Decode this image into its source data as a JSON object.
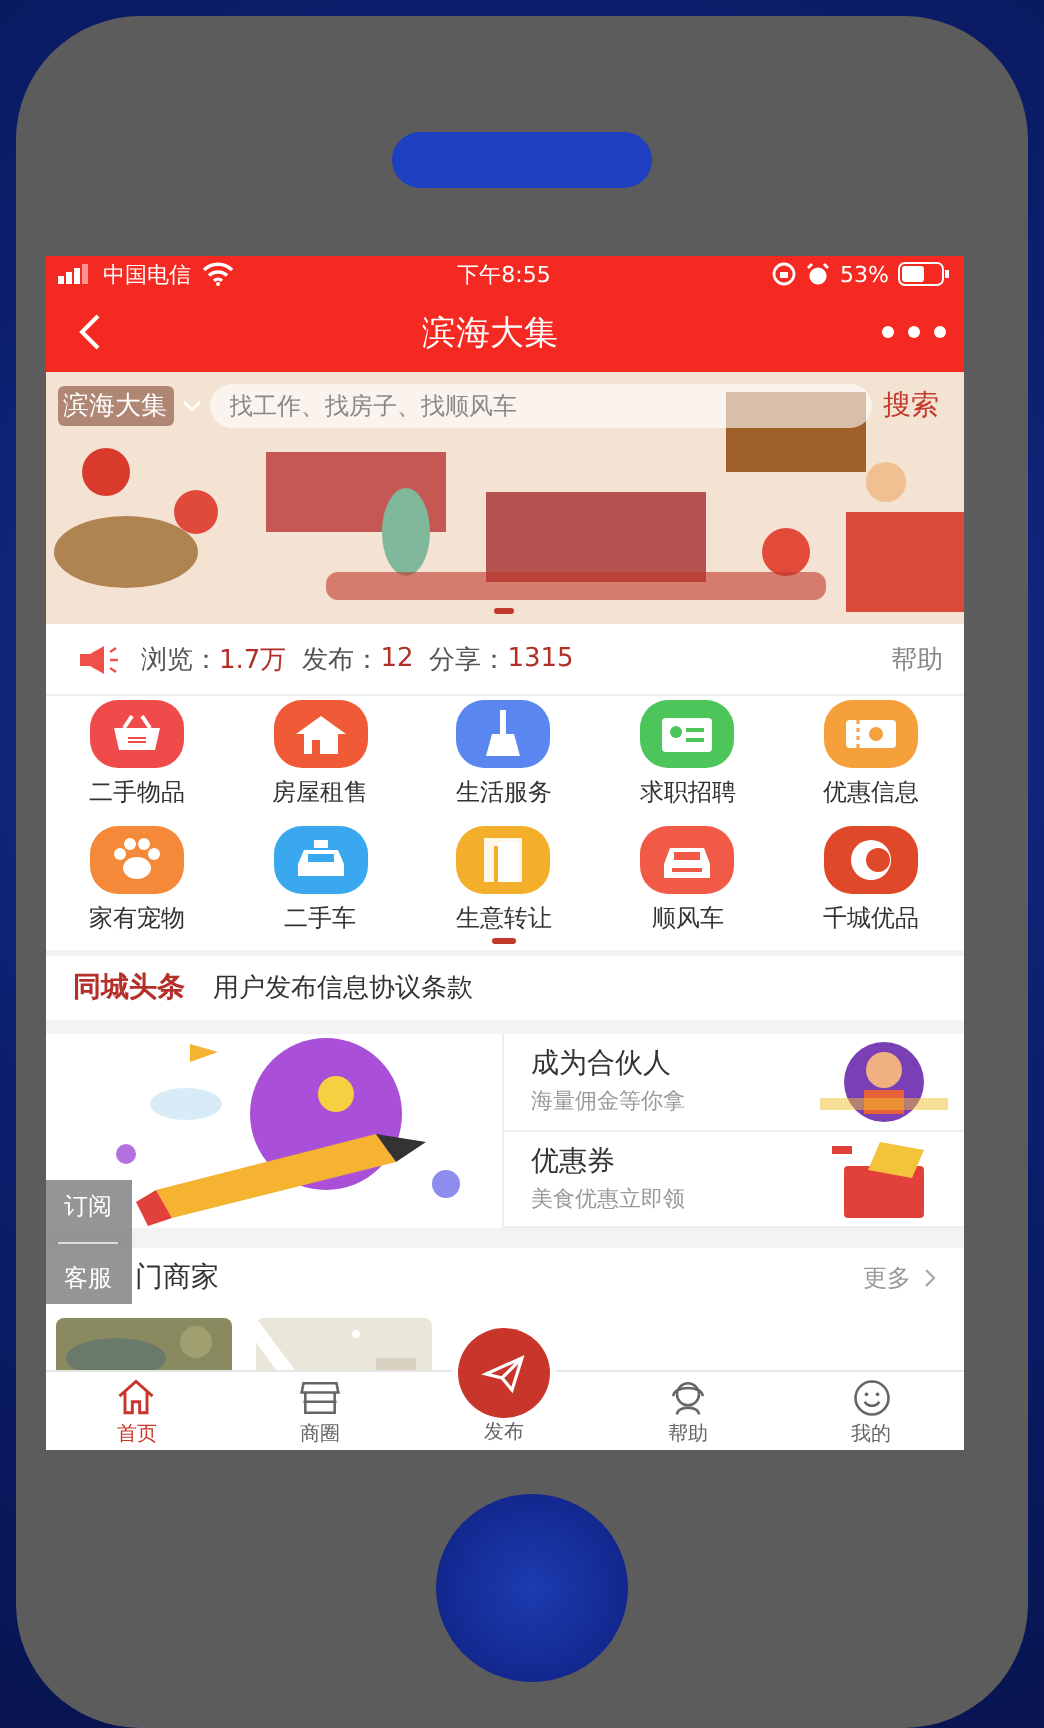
{
  "status_bar": {
    "carrier": "中国电信",
    "time": "下午8:55",
    "battery": "53%"
  },
  "header": {
    "title": "滨海大集"
  },
  "banner": {
    "city": "滨海大集",
    "search_placeholder": "找工作、找房子、找顺风车",
    "search_button": "搜索"
  },
  "stats": [
    {
      "label": "浏览：",
      "value": "1.7万"
    },
    {
      "label": "发布：",
      "value": "12"
    },
    {
      "label": "分享：",
      "value": "1315"
    }
  ],
  "help": "帮助",
  "categories": [
    {
      "label": "二手物品",
      "color": "#f04b4b"
    },
    {
      "label": "房屋租售",
      "color": "#f05a36"
    },
    {
      "label": "生活服务",
      "color": "#5a86f0"
    },
    {
      "label": "求职招聘",
      "color": "#4cc65a"
    },
    {
      "label": "优惠信息",
      "color": "#f5a03a"
    },
    {
      "label": "家有宠物",
      "color": "#f5893a"
    },
    {
      "label": "二手车",
      "color": "#3aa8ef"
    },
    {
      "label": "生意转让",
      "color": "#f3ae2c"
    },
    {
      "label": "顺风车",
      "color": "#f25a48"
    },
    {
      "label": "千城优品",
      "color": "#e0482a"
    }
  ],
  "headline": {
    "tag": "同城头条",
    "text": "用户发布信息协议条款"
  },
  "promos": [
    {
      "title": "成为合伙人",
      "subtitle": "海量佣金等你拿"
    },
    {
      "title": "优惠券",
      "subtitle": "美食优惠立即领"
    }
  ],
  "float_menu": [
    "订阅",
    "客服"
  ],
  "merchants": {
    "title": "门商家",
    "more": "更多"
  },
  "tabs": [
    {
      "label": "首页",
      "kind": "tab",
      "selected": true
    },
    {
      "label": "商圈",
      "kind": "tab",
      "selected": false
    },
    {
      "label": "发布",
      "kind": "publish",
      "selected": false
    },
    {
      "label": "帮助",
      "kind": "tab",
      "selected": false
    },
    {
      "label": "我的",
      "kind": "tab",
      "selected": false
    }
  ]
}
